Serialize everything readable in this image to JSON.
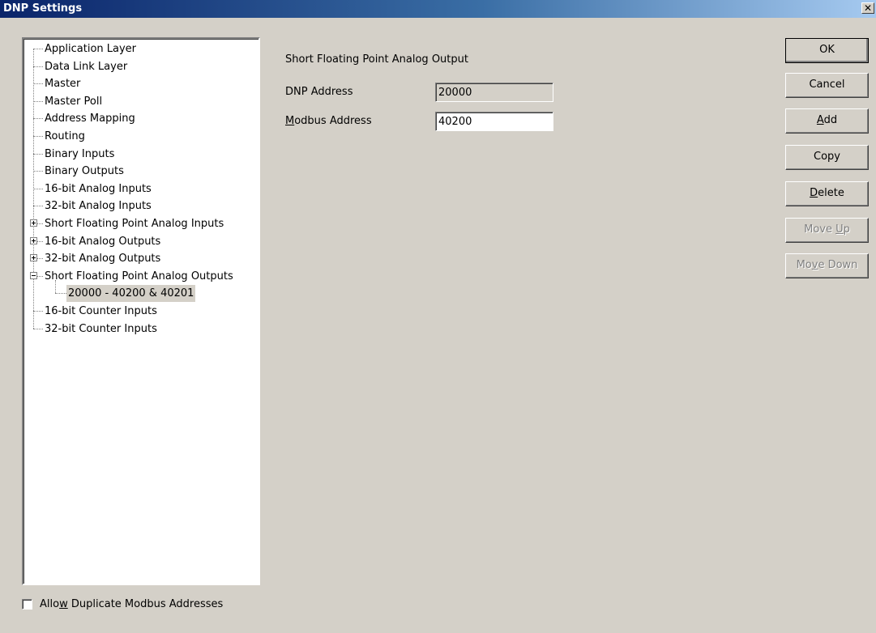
{
  "window": {
    "title": "DNP Settings",
    "close_glyph": "✕"
  },
  "tree": {
    "items": [
      {
        "label": "Application Layer",
        "expander": null,
        "level": 0
      },
      {
        "label": "Data Link Layer",
        "expander": null,
        "level": 0
      },
      {
        "label": "Master",
        "expander": null,
        "level": 0
      },
      {
        "label": "Master Poll",
        "expander": null,
        "level": 0
      },
      {
        "label": "Address Mapping",
        "expander": null,
        "level": 0
      },
      {
        "label": "Routing",
        "expander": null,
        "level": 0
      },
      {
        "label": "Binary Inputs",
        "expander": null,
        "level": 0
      },
      {
        "label": "Binary Outputs",
        "expander": null,
        "level": 0
      },
      {
        "label": "16-bit Analog Inputs",
        "expander": null,
        "level": 0
      },
      {
        "label": "32-bit Analog Inputs",
        "expander": null,
        "level": 0
      },
      {
        "label": "Short Floating Point Analog Inputs",
        "expander": "plus",
        "level": 0
      },
      {
        "label": "16-bit Analog Outputs",
        "expander": "plus",
        "level": 0
      },
      {
        "label": "32-bit Analog Outputs",
        "expander": "plus",
        "level": 0
      },
      {
        "label": "Short Floating Point Analog Outputs",
        "expander": "minus",
        "level": 0
      },
      {
        "label": "20000 - 40200 & 40201",
        "expander": null,
        "level": 1,
        "selected": true
      },
      {
        "label": "16-bit Counter Inputs",
        "expander": null,
        "level": 0
      },
      {
        "label": "32-bit Counter Inputs",
        "expander": null,
        "level": 0
      }
    ]
  },
  "detail": {
    "heading": "Short Floating Point Analog Output",
    "dnp_address": {
      "label": "DNP Address",
      "value": "20000"
    },
    "modbus_address": {
      "label_accel": "M",
      "label_rest": "odbus Address",
      "value": "40200"
    }
  },
  "buttons": {
    "ok": {
      "label": "OK"
    },
    "cancel": {
      "label": "Cancel"
    },
    "add": {
      "accel": "A",
      "rest": "dd"
    },
    "copy": {
      "label": "Copy"
    },
    "delete": {
      "accel": "D",
      "rest": "elete"
    },
    "move_up": {
      "pre": "Move ",
      "accel": "U",
      "rest": "p"
    },
    "move_down": {
      "pre": "Mo",
      "accel": "v",
      "rest": "e Down"
    }
  },
  "options": {
    "allow_duplicate": {
      "pre": "Allo",
      "accel": "w",
      "rest": " Duplicate Modbus Addresses",
      "checked": false
    }
  }
}
